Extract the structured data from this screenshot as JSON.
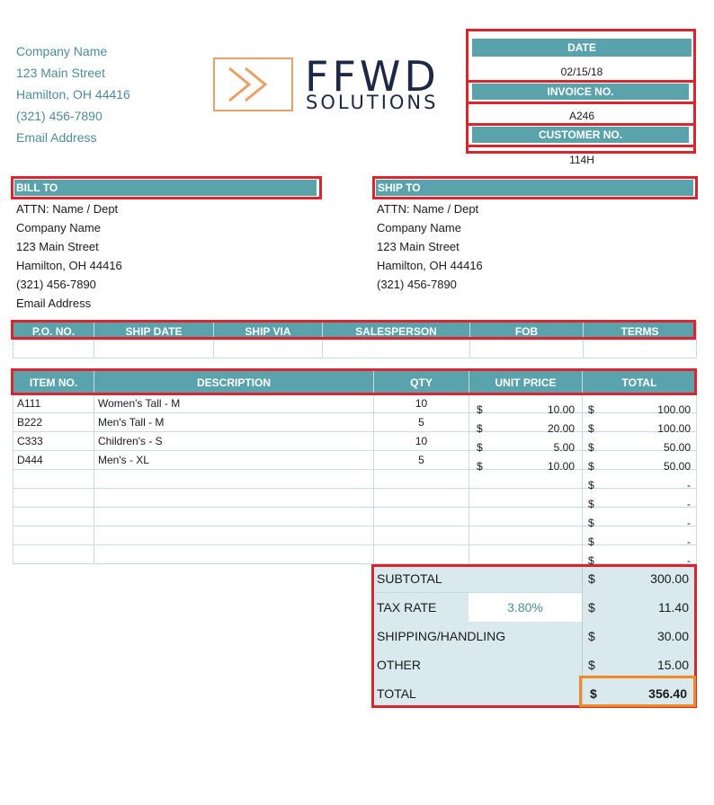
{
  "company": {
    "name": "Company Name",
    "street": "123 Main Street",
    "city": "Hamilton, OH  44416",
    "phone": "(321) 456-7890",
    "email": "Email Address"
  },
  "logo": {
    "word": "FFWD",
    "sub": "SOLUTIONS"
  },
  "meta": {
    "date_label": "DATE",
    "date": "02/15/18",
    "invoice_label": "INVOICE NO.",
    "invoice": "A246",
    "customer_label": "CUSTOMER NO.",
    "customer": "114H"
  },
  "bill_to": {
    "label": "BILL TO",
    "lines": [
      "ATTN: Name / Dept",
      "Company Name",
      "123 Main Street",
      "Hamilton, OH  44416",
      "(321) 456-7890",
      "Email Address"
    ]
  },
  "ship_to": {
    "label": "SHIP TO",
    "lines": [
      "ATTN: Name / Dept",
      "Company Name",
      "123 Main Street",
      "Hamilton, OH  44416",
      "(321) 456-7890"
    ]
  },
  "order_headers": [
    "P.O. NO.",
    "SHIP DATE",
    "SHIP VIA",
    "SALESPERSON",
    "FOB",
    "TERMS"
  ],
  "item_headers": [
    "ITEM NO.",
    "DESCRIPTION",
    "QTY",
    "UNIT PRICE",
    "TOTAL"
  ],
  "items": [
    {
      "no": "A111",
      "desc": "Women's Tall - M",
      "qty": "10",
      "cur": "$",
      "price": "10.00",
      "tcur": "$",
      "total": "100.00"
    },
    {
      "no": "B222",
      "desc": "Men's Tall - M",
      "qty": "5",
      "cur": "$",
      "price": "20.00",
      "tcur": "$",
      "total": "100.00"
    },
    {
      "no": "C333",
      "desc": "Children's - S",
      "qty": "10",
      "cur": "$",
      "price": "5.00",
      "tcur": "$",
      "total": "50.00"
    },
    {
      "no": "D444",
      "desc": "Men's - XL",
      "qty": "5",
      "cur": "$",
      "price": "10.00",
      "tcur": "$",
      "total": "50.00"
    },
    {
      "no": "",
      "desc": "",
      "qty": "",
      "cur": "",
      "price": "",
      "tcur": "$",
      "total": "-"
    },
    {
      "no": "",
      "desc": "",
      "qty": "",
      "cur": "",
      "price": "",
      "tcur": "$",
      "total": "-"
    },
    {
      "no": "",
      "desc": "",
      "qty": "",
      "cur": "",
      "price": "",
      "tcur": "$",
      "total": "-"
    },
    {
      "no": "",
      "desc": "",
      "qty": "",
      "cur": "",
      "price": "",
      "tcur": "$",
      "total": "-"
    },
    {
      "no": "",
      "desc": "",
      "qty": "",
      "cur": "",
      "price": "",
      "tcur": "$",
      "total": "-"
    }
  ],
  "summary": {
    "subtotal_label": "SUBTOTAL",
    "subtotal_cur": "$",
    "subtotal": "300.00",
    "tax_label": "TAX RATE",
    "tax_rate": "3.80%",
    "tax_cur": "$",
    "tax": "11.40",
    "shipping_label": "SHIPPING/HANDLING",
    "shipping_cur": "$",
    "shipping": "30.00",
    "other_label": "OTHER",
    "other_cur": "$",
    "other": "15.00",
    "total_label": "TOTAL",
    "total_cur": "$",
    "total": "356.40"
  },
  "colors": {
    "accent": "#5aa3ac",
    "highlight": "#d9262e",
    "total_box": "#f08a24",
    "logo_orange": "#e8a064",
    "logo_navy": "#1d2746"
  }
}
